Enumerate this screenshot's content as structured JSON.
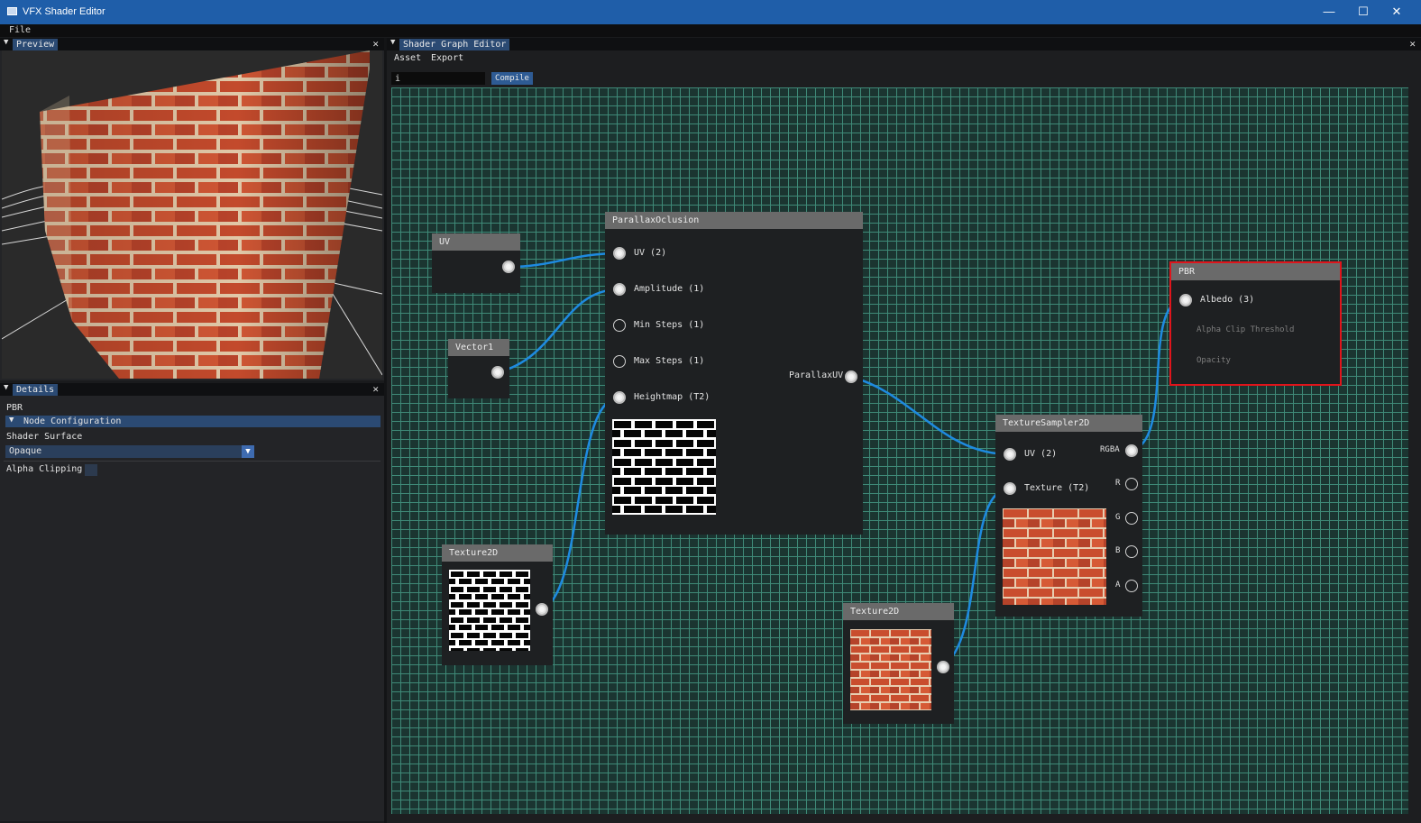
{
  "window": {
    "title": "VFX Shader Editor"
  },
  "menubar": {
    "file": "File"
  },
  "preview_panel": {
    "title": "Preview"
  },
  "details_panel": {
    "title": "Details",
    "node_name": "PBR",
    "section": "Node Configuration",
    "shader_surface_label": "Shader Surface",
    "shader_surface_value": "Opaque",
    "alpha_clipping_label": "Alpha Clipping"
  },
  "graph_panel": {
    "title": "Shader Graph Editor",
    "menu": [
      "Asset",
      "Export"
    ],
    "search_value": "i",
    "compile_label": "Compile"
  },
  "nodes": {
    "uv": {
      "title": "UV"
    },
    "vector1": {
      "title": "Vector1"
    },
    "parallax": {
      "title": "ParallaxOclusion",
      "inputs": [
        "UV (2)",
        "Amplitude (1)",
        "Min Steps (1)",
        "Max Steps (1)",
        "Heightmap (T2)"
      ],
      "output": "ParallaxUV"
    },
    "texture2d_a": {
      "title": "Texture2D"
    },
    "texture2d_b": {
      "title": "Texture2D"
    },
    "sampler": {
      "title": "TextureSampler2D",
      "inputs": [
        "UV (2)",
        "Texture (T2)"
      ],
      "outputs": [
        "RGBA",
        "R",
        "G",
        "B",
        "A"
      ]
    },
    "pbr": {
      "title": "PBR",
      "inputs": [
        "Albedo (3)",
        "Alpha Clip Threshold",
        "Opacity"
      ]
    }
  },
  "colors": {
    "accent": "#2b4a73",
    "wire": "#1e8ae0",
    "grid": "#3f8a78",
    "pbr_border": "#e0141b",
    "brick": "#c64a2c"
  }
}
